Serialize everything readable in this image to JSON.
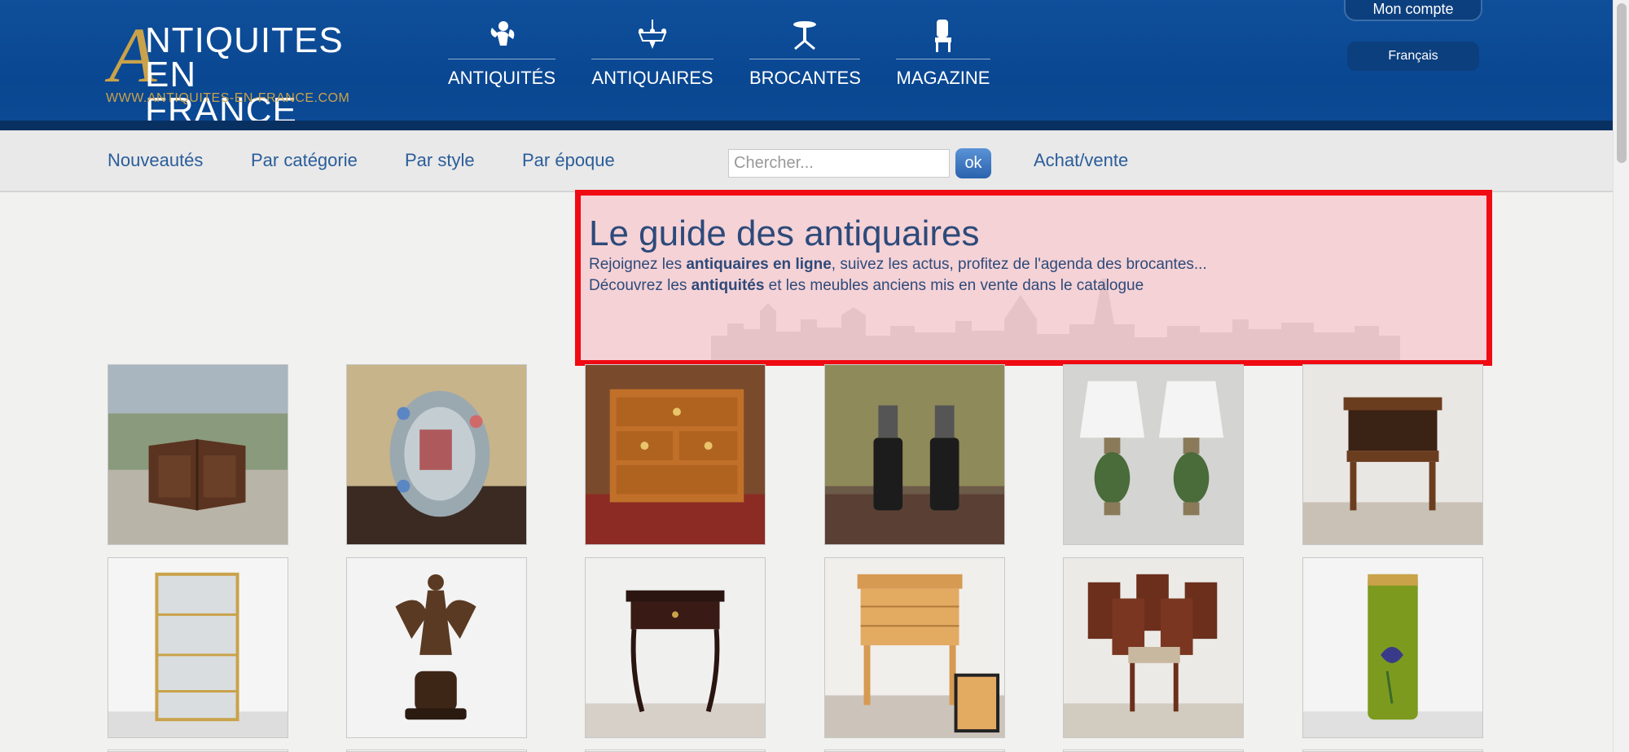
{
  "header": {
    "logo_letter": "A",
    "logo_line1": "NTIQUITES",
    "logo_line2": "EN FRANCE",
    "logo_url": "WWW.ANTIQUITES-EN-FRANCE.COM",
    "nav": [
      {
        "label": "ANTIQUITÉS",
        "icon": "cherub-icon"
      },
      {
        "label": "ANTIQUAIRES",
        "icon": "chandelier-icon"
      },
      {
        "label": "BROCANTES",
        "icon": "pedestal-table-icon"
      },
      {
        "label": "MAGAZINE",
        "icon": "chair-icon"
      }
    ],
    "account_label": "Mon compte",
    "language_label": "Français"
  },
  "subnav": {
    "links": [
      "Nouveautés",
      "Par catégorie",
      "Par style",
      "Par époque"
    ],
    "search_placeholder": "Chercher...",
    "ok_label": "ok",
    "buy_sell_label": "Achat/vente"
  },
  "guide": {
    "title": "Le guide des antiquaires",
    "line1_pre": "Rejoignez les ",
    "line1_bold": "antiquaires en ligne",
    "line1_post": ", suivez les actus, profitez de l'agenda des brocantes...",
    "line2_pre": "Découvrez les ",
    "line2_bold": "antiquités",
    "line2_post": " et les meubles anciens mis en vente dans le catalogue"
  },
  "colors": {
    "header_blue": "#0a4792",
    "link_blue": "#2a5d9a",
    "gold": "#c9a24a",
    "highlight_red": "#f00a12"
  },
  "products": [
    {
      "name": "corner-cabinet-photo"
    },
    {
      "name": "venetian-mirror-photo"
    },
    {
      "name": "marquetry-commode-photo"
    },
    {
      "name": "oil-lamps-pair-photo"
    },
    {
      "name": "porcelain-lamps-pair-photo"
    },
    {
      "name": "bedside-table-photo"
    },
    {
      "name": "brass-vitrine-photo"
    },
    {
      "name": "bronze-angel-sculpture-photo"
    },
    {
      "name": "napoleon-iii-side-table-photo"
    },
    {
      "name": "dressing-table-photo"
    },
    {
      "name": "dining-chairs-set-photo"
    },
    {
      "name": "glass-vase-iris-photo"
    }
  ]
}
